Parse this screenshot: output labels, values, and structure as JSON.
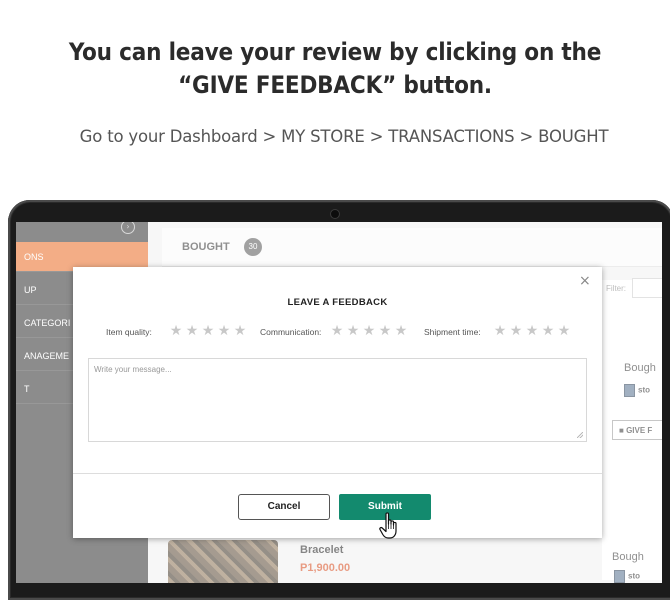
{
  "headline": {
    "line1": "You can leave your review by clicking on the",
    "line2": "“GIVE FEEDBACK” button."
  },
  "instructions": "Go to your Dashboard > MY STORE > TRANSACTIONS > BOUGHT",
  "sidebar": {
    "items": [
      {
        "label": "ONS",
        "active": true
      },
      {
        "label": "UP"
      },
      {
        "label": "CATEGORI"
      },
      {
        "label": "ANAGEME"
      },
      {
        "label": "T"
      }
    ]
  },
  "header": {
    "title": "BOUGHT",
    "count": "30"
  },
  "filter_label": "Filter:",
  "right_panel": {
    "bought_label_1": "Bough",
    "store_label_1": "sto",
    "give_feedback_label": "GIVE F",
    "bought_label_2": "Bough",
    "store_label_2": "sto"
  },
  "product": {
    "name": "Bracelet",
    "price": "P1,900.00"
  },
  "modal": {
    "title": "LEAVE A FEEDBACK",
    "ratings": [
      {
        "label": "Item quality:",
        "stars": 5,
        "filled": 0
      },
      {
        "label": "Communication:",
        "stars": 5,
        "filled": 0
      },
      {
        "label": "Shipment time:",
        "stars": 5,
        "filled": 0
      }
    ],
    "message_placeholder": "Write your message...",
    "cancel_label": "Cancel",
    "submit_label": "Submit",
    "close_glyph": "×"
  },
  "colors": {
    "accent_orange": "#e96b23",
    "submit_green": "#138a6e",
    "price_red": "#d64a1d"
  }
}
